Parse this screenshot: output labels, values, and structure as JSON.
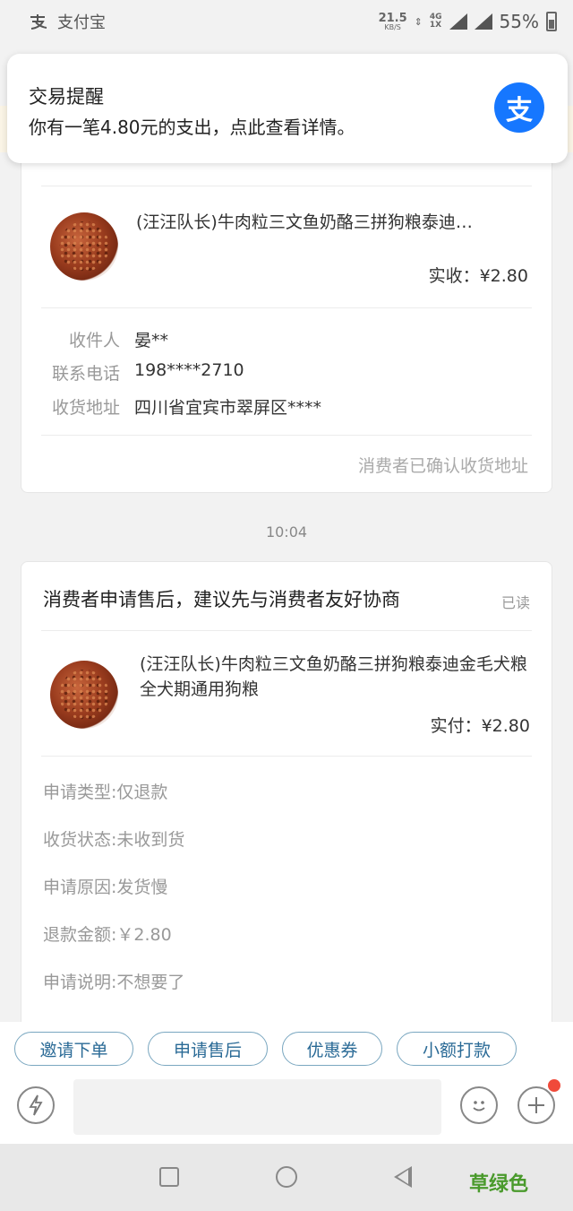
{
  "status_bar": {
    "app_name": "支付宝",
    "speed_value": "21.5",
    "speed_unit": "KB/S",
    "network_top": "4G",
    "network_bottom": "1X",
    "battery": "55%"
  },
  "notification": {
    "title": "交易提醒",
    "body": "你有一笔4.80元的支出，点此查看详情。",
    "logo_glyph": "支"
  },
  "order_card": {
    "product_title": "(汪汪队长)牛肉粒三文鱼奶酪三拼狗粮泰迪…",
    "price_label": "实收：¥2.80",
    "fields": [
      {
        "key": "收件人",
        "value": "晏**"
      },
      {
        "key": "联系电话",
        "value": "198****2710"
      },
      {
        "key": "收货地址",
        "value": "四川省宜宾市翠屏区****"
      }
    ],
    "confirm_text": "消费者已确认收货地址"
  },
  "timestamp": "10:04",
  "aftersale_card": {
    "header": "消费者申请售后，建议先与消费者友好协商",
    "read_status": "已读",
    "product_title": "(汪汪队长)牛肉粒三文鱼奶酪三拼狗粮泰迪金毛犬粮全犬期通用狗粮",
    "price_label": "实付：¥2.80",
    "rows": [
      "申请类型:仅退款",
      "收货状态:未收到货",
      "申请原因:发货慢",
      "退款金额:￥2.80",
      "申请说明:不想要了"
    ]
  },
  "quick_actions": [
    "邀请下单",
    "申请售后",
    "优惠券",
    "小额打款"
  ],
  "watermark": "草绿色",
  "colors": {
    "alipay_blue": "#1677ff",
    "quick_button_text": "#2a6a96",
    "notification_dot": "#f04a3a"
  }
}
